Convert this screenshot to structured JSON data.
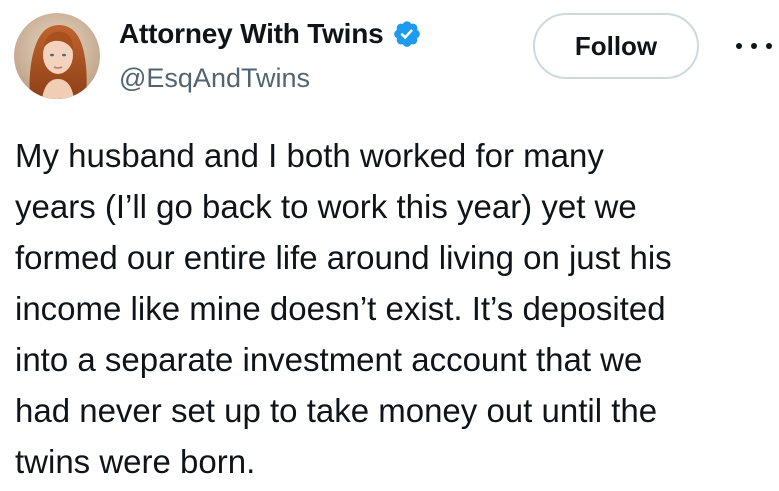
{
  "author": {
    "display_name": "Attorney With Twins",
    "handle": "@EsqAndTwins",
    "verified": true,
    "avatar_icon": "profile-photo"
  },
  "actions": {
    "follow_label": "Follow",
    "more_icon": "more-horizontal-icon"
  },
  "tweet": {
    "lines": [
      "My husband and I both worked for many",
      "years (I’ll go back to work this year) yet we",
      "formed our entire life around living on just his",
      "income like mine doesn’t exist. It’s deposited",
      "into a separate investment account that we",
      "had never set up to take money out until the",
      "twins were born."
    ]
  },
  "colors": {
    "text": "#0f1419",
    "secondary": "#536471",
    "verified_blue": "#1d9bf0",
    "button_border": "#cfd9de"
  }
}
